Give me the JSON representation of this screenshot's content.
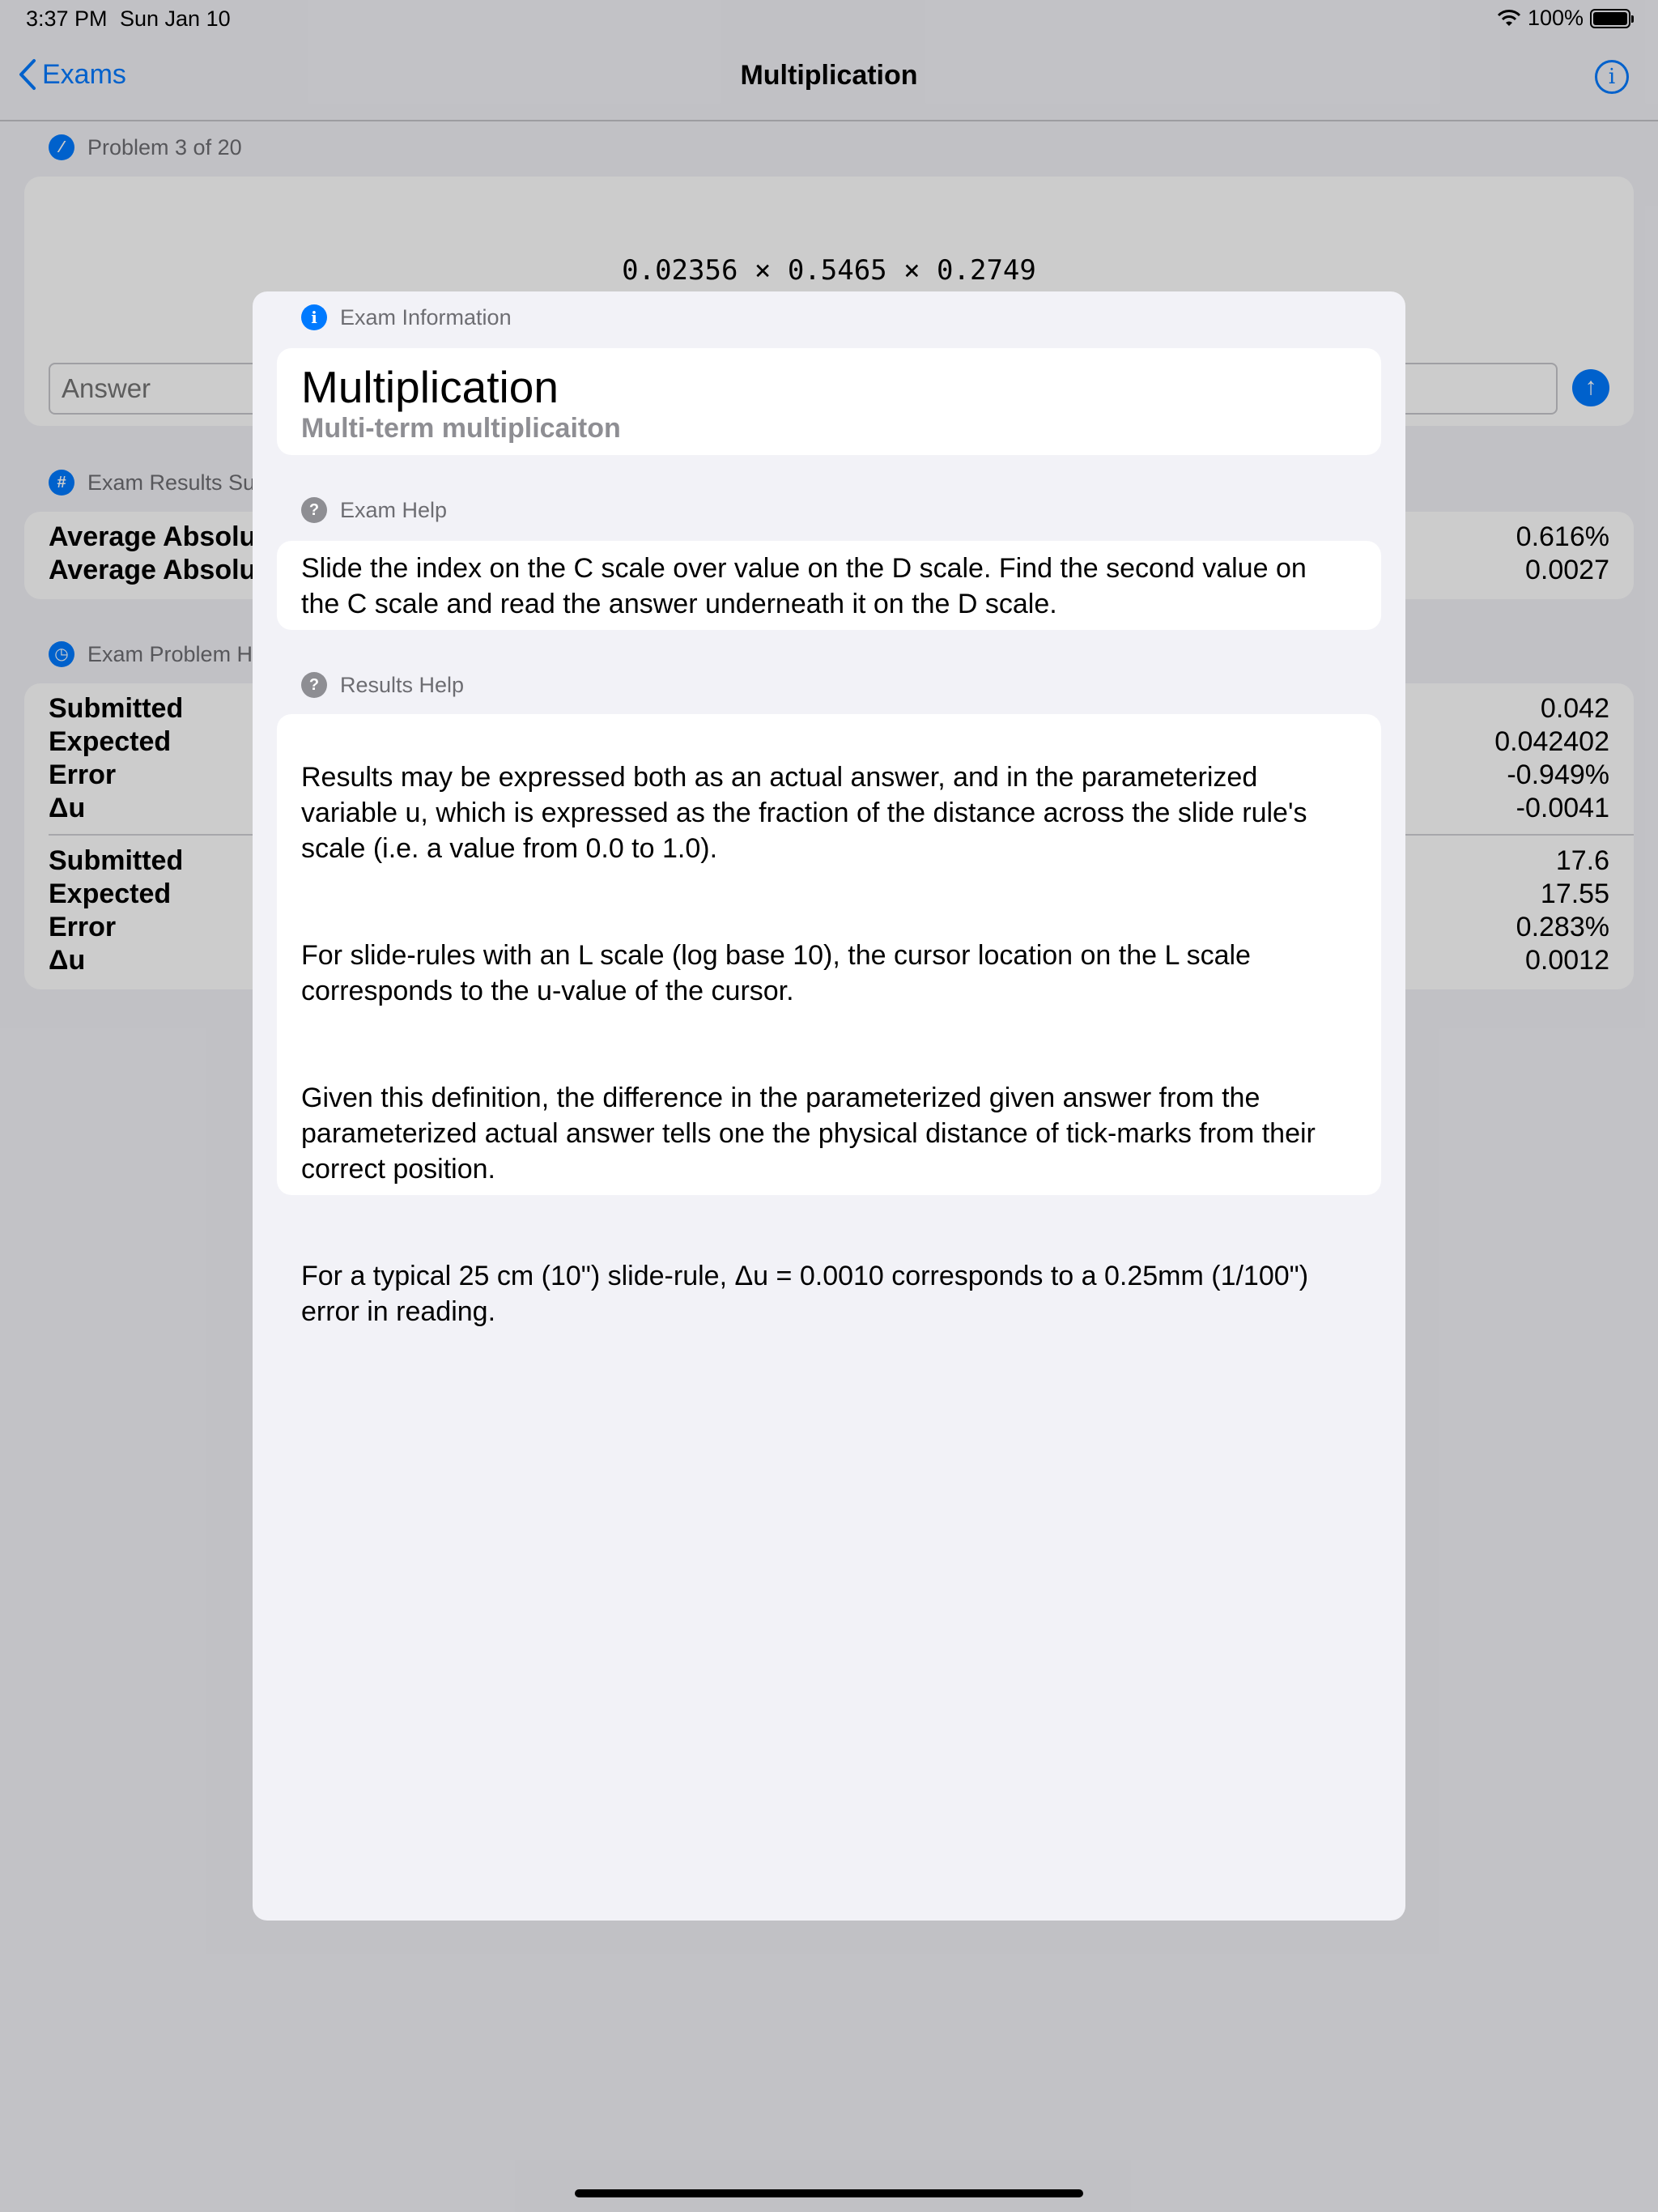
{
  "status_bar": {
    "time": "3:37 PM",
    "date": "Sun Jan 10",
    "battery": "100%"
  },
  "nav": {
    "back_label": "Exams",
    "title": "Multiplication"
  },
  "problem": {
    "section_label": "Problem 3 of 20",
    "expression": "0.02356 × 0.5465 × 0.2749",
    "answer_placeholder": "Answer"
  },
  "results_summary": {
    "section_label": "Exam Results Su",
    "rows": [
      {
        "label": "Average Absolu",
        "value": "0.616%"
      },
      {
        "label": "Average Absolu",
        "value": "0.0027"
      }
    ]
  },
  "history": {
    "section_label": "Exam Problem Hi",
    "groups": [
      {
        "submitted_label": "Submitted",
        "submitted": "0.042",
        "expected_label": "Expected",
        "expected": "0.042402",
        "error_label": "Error",
        "error": "-0.949%",
        "du_label": "Δu",
        "du": "-0.0041"
      },
      {
        "submitted_label": "Submitted",
        "submitted": "17.6",
        "expected_label": "Expected",
        "expected": "17.55",
        "error_label": "Error",
        "error": "0.283%",
        "du_label": "Δu",
        "du": "0.0012"
      }
    ]
  },
  "sheet": {
    "info_header": "Exam Information",
    "title": "Multiplication",
    "subtitle": "Multi-term multiplicaiton",
    "exam_help_header": "Exam Help",
    "exam_help_text": "Slide the index on the C scale over value on the D scale.  Find the second value on\nthe C scale and read the answer underneath it on the D scale.",
    "results_help_header": "Results Help",
    "results_help_paragraphs": [
      "Results may be expressed both as an actual answer, and in the parameterized\nvariable u, which is expressed as the fraction of the distance across the slide rule's\nscale (i.e. a value from 0.0 to 1.0).",
      "For slide-rules with an L scale (log base 10), the cursor location on the L scale\ncorresponds to the u-value of the cursor.",
      "Given this definition, the difference in the parameterized given answer from the\nparameterized actual answer tells one the physical distance of tick-marks from their\ncorrect position.",
      "For a typical 25 cm (10\") slide-rule, Δu = 0.0010 corresponds to a 0.25mm (1/100\")\nerror in reading."
    ]
  },
  "colors": {
    "accent": "#007aff",
    "secondary_text": "#6d6d72",
    "background": "#f2f2f7"
  }
}
